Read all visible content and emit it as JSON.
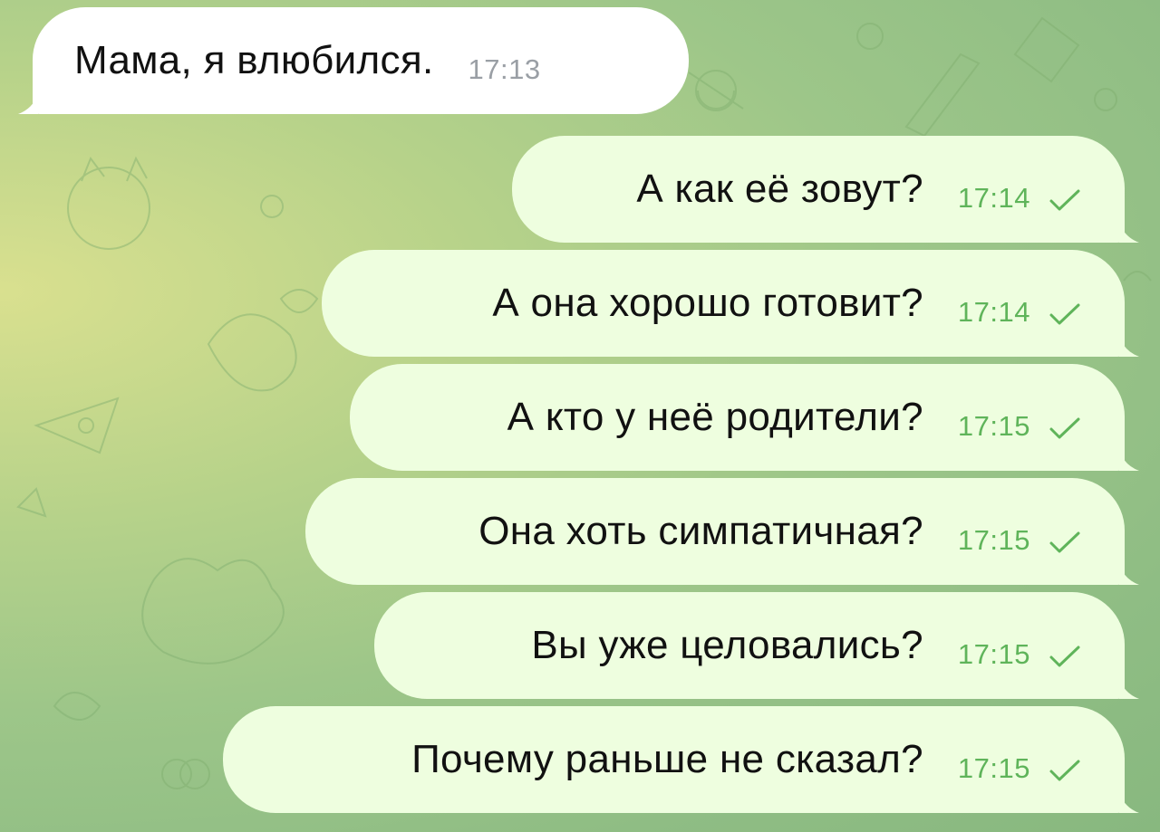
{
  "chat": {
    "messages": [
      {
        "direction": "incoming",
        "text": "Мама, я влюбился.",
        "time": "17:13"
      },
      {
        "direction": "outgoing",
        "text": "А как её зовут?",
        "time": "17:14",
        "status": "sent-check-icon"
      },
      {
        "direction": "outgoing",
        "text": "А она хорошо готовит?",
        "time": "17:14",
        "status": "sent-check-icon"
      },
      {
        "direction": "outgoing",
        "text": "А кто у неё родители?",
        "time": "17:15",
        "status": "sent-check-icon"
      },
      {
        "direction": "outgoing",
        "text": "Она хоть симпатичная?",
        "time": "17:15",
        "status": "sent-check-icon"
      },
      {
        "direction": "outgoing",
        "text": "Вы уже целовались?",
        "time": "17:15",
        "status": "sent-check-icon"
      },
      {
        "direction": "outgoing",
        "text": "Почему раньше не сказал?",
        "time": "17:15",
        "status": "sent-check-icon"
      }
    ]
  },
  "colors": {
    "background": "#9dc689",
    "incoming_bubble": "#ffffff",
    "outgoing_bubble": "#eefedf",
    "outgoing_meta": "#5fb45a",
    "incoming_meta": "#9a9fa5"
  }
}
